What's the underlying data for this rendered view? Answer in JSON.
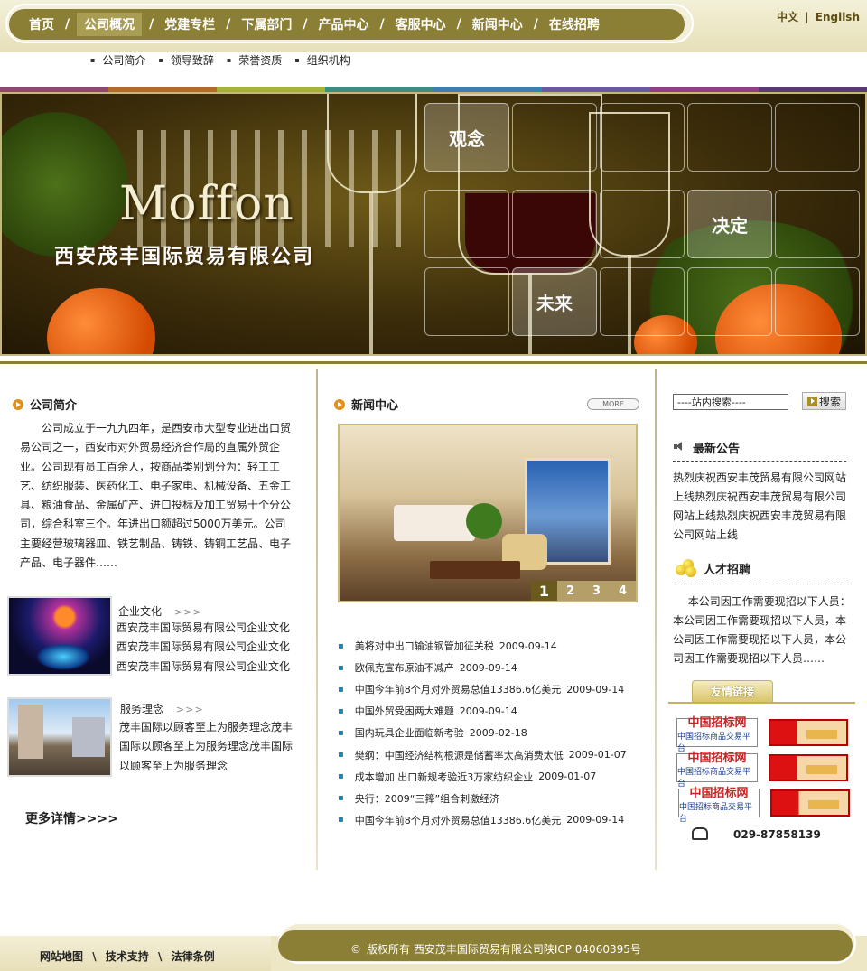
{
  "nav": {
    "items": [
      "首页",
      "公司概况",
      "党建专栏",
      "下属部门",
      "产品中心",
      "客服中心",
      "新闻中心",
      "在线招聘"
    ],
    "sep": "/",
    "lang_cn": "中文",
    "lang_sep": "|",
    "lang_en": "English"
  },
  "subnav": [
    "公司简介",
    "领导致辞",
    "荣誉资质",
    "组织机构"
  ],
  "colorbar": [
    "#8b4a6a",
    "#b36b2b",
    "#a5b23a",
    "#3d8f7d",
    "#3a7fb3",
    "#6a5aa5",
    "#8f3f8a",
    "#5b3a7a"
  ],
  "banner": {
    "brand": "Moffon",
    "company": "西安茂丰国际贸易有限公司",
    "words": [
      "观念",
      "决定",
      "未来"
    ]
  },
  "intro": {
    "title": "公司简介",
    "text": "公司成立于一九九四年，是西安市大型专业进出口贸易公司之一，西安市对外贸易经济合作局的直属外贸企业。公司现有员工百余人，按商品类别划分为：轻工工艺、纺织服装、医药化工、电子家电、机械设备、五金工具、粮油食品、金属矿产、进口投标及加工贸易十个分公司，综合科室三个。年进出口额超过5000万美元。公司主要经营玻璃器皿、铁艺制品、铸铁、铸铜工艺品、电子产品、电子器件……"
  },
  "cards": [
    {
      "title": "企业文化",
      "arrows": ">>>",
      "lines": [
        "西安茂丰国际贸易有限公司企业文化",
        "西安茂丰国际贸易有限公司企业文化",
        "西安茂丰国际贸易有限公司企业文化"
      ]
    },
    {
      "title": "服务理念",
      "arrows": ">>>",
      "lines": [
        "茂丰国际以顾客至上为服务理念茂丰",
        "国际以顾客至上为服务理念茂丰国际",
        "以顾客至上为服务理念"
      ]
    }
  ],
  "more_detail": "更多详情>>>>",
  "news": {
    "title": "新闻中心",
    "more": "MORE",
    "pages": [
      "1",
      "2",
      "3",
      "4"
    ],
    "items": [
      {
        "text": "美将对中出口输油钢管加征关税",
        "date": "2009-09-14"
      },
      {
        "text": "欧佩克宣布原油不减产",
        "date": "2009-09-14"
      },
      {
        "text": "中国今年前8个月对外贸易总值13386.6亿美元",
        "date": "2009-09-14"
      },
      {
        "text": "中国外贸受困两大难题",
        "date": "2009-09-14"
      },
      {
        "text": "国内玩具企业面临新考验",
        "date": "2009-02-18"
      },
      {
        "text": "樊纲：中国经济结构根源是储蓄率太高消费太低",
        "date": "2009-01-07"
      },
      {
        "text": "成本增加 出口新规考验近3万家纺织企业",
        "date": "2009-01-07"
      },
      {
        "text": "央行：2009“三箨”组合刺激经济",
        "date": ""
      },
      {
        "text": "中国今年前8个月对外贸易总值13386.6亿美元",
        "date": "2009-09-14"
      }
    ]
  },
  "search": {
    "value": "----站内搜索----",
    "button": "搜索"
  },
  "notice": {
    "title": "最新公告",
    "text": "热烈庆祝西安丰茂贸易有限公司网站上线热烈庆祝西安丰茂贸易有限公司网站上线热烈庆祝西安丰茂贸易有限公司网站上线"
  },
  "jobs": {
    "title": "人才招聘",
    "text": "本公司因工作需要现招以下人员：本公司因工作需要现招以下人员，本公司因工作需要现招以下人员，本公司因工作需要现招以下人员……"
  },
  "links": {
    "title": "友情链接",
    "logo_a_big": "中国招标网",
    "logo_a_small": "中国招标商品交易平台"
  },
  "phone": "029-87858139",
  "footer": {
    "links": [
      "网站地图",
      "技术支持",
      "法律条例"
    ],
    "sep": "\\",
    "copyright_sym": "©",
    "copyright": "版权所有 西安茂丰国际贸易有限公司陕ICP 04060395号"
  }
}
